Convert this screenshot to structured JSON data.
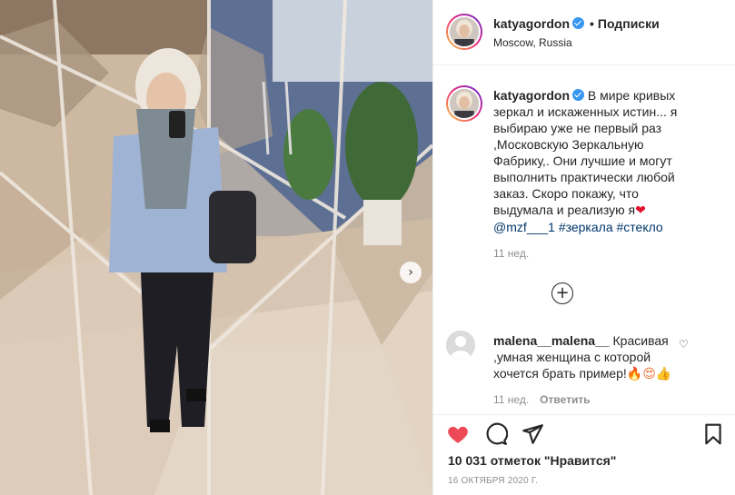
{
  "post": {
    "username": "katyagordon",
    "verified": true,
    "follow_label": "Подписки",
    "location": "Moscow, Russia",
    "caption": {
      "username": "katyagordon",
      "text": "В мире кривых зеркал и искаженных истин... я выбираю уже не первый раз ,Московскую Зеркальную Фабрику,. Они лучшие и могут выполнить практически любой заказ. Скоро покажу, что выдумала и реализую я",
      "emoji": "❤",
      "tags": [
        "@mzf___1",
        "#зеркала",
        "#стекло"
      ],
      "time": "11 нед."
    },
    "comments": [
      {
        "username": "malena__malena__",
        "text": "Красивая ,умная женщина с которой хочется брать пример!",
        "emoji": "🔥😍👍",
        "time": "11 нед.",
        "reply_label": "Ответить"
      }
    ],
    "likes_text": "10 031 отметок \"Нравится\"",
    "date": "16 ОКТЯБРЯ 2020 Г.",
    "icons": {
      "like": "heart-icon",
      "comment": "comment-bubble-icon",
      "share": "paper-plane-icon",
      "save": "bookmark-icon",
      "load_more": "plus-circle-icon",
      "carousel_next": "chevron-right-icon",
      "comment_like": "small-heart-icon"
    },
    "colors": {
      "liked": "#ed4956",
      "link": "#00376b",
      "verified": "#3897f0",
      "muted": "#8e8e8e"
    }
  }
}
